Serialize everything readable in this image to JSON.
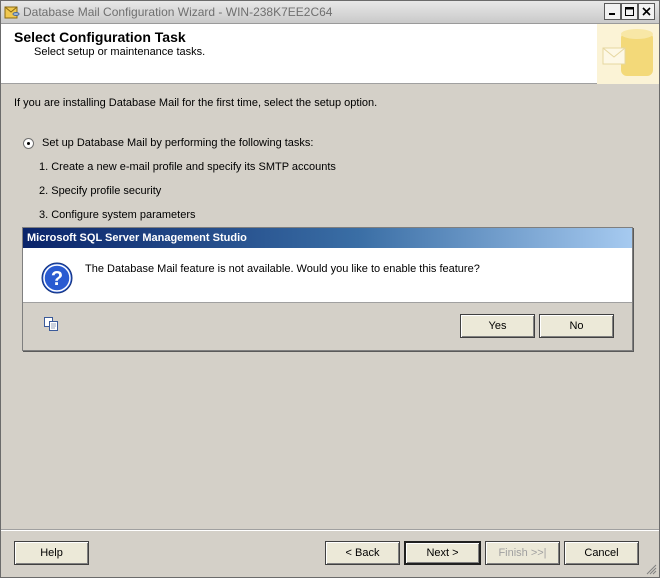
{
  "window": {
    "title": "Database Mail Configuration Wizard - WIN-238K7EE2C64"
  },
  "header": {
    "title": "Select Configuration Task",
    "subtitle": "Select setup or maintenance tasks."
  },
  "main": {
    "intro": "If you are installing Database Mail for the first time, select the setup option.",
    "setup_option": {
      "label": "Set up Database Mail by performing the following tasks:",
      "selected": true,
      "tasks": [
        "1. Create a new e-mail profile and specify its SMTP accounts",
        "2. Specify profile security",
        "3. Configure system parameters"
      ]
    }
  },
  "dialog": {
    "title": "Microsoft SQL Server Management Studio",
    "message": "The Database Mail feature is not available.  Would you like to enable this feature?",
    "icon": "question-icon",
    "yes_label": "Yes",
    "no_label": "No"
  },
  "footer": {
    "help_label": "Help",
    "back_label": "< Back",
    "next_label": "Next >",
    "finish_label": "Finish >>|",
    "cancel_label": "Cancel"
  },
  "colors": {
    "dialog_title_start": "#0a246a",
    "dialog_title_end": "#a6caf0",
    "face": "#d4d0c8"
  }
}
